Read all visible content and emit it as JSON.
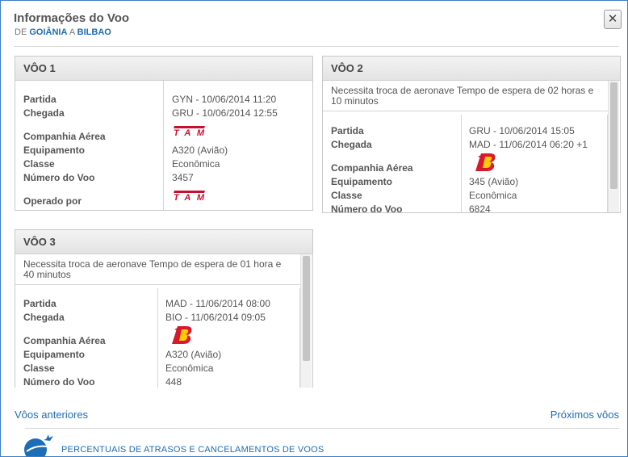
{
  "header": {
    "title": "Informações do Voo",
    "de": "DE",
    "origin": "GOIÂNIA",
    "a": "A",
    "destination": "BILBAO",
    "close_glyph": "✕"
  },
  "flights": [
    {
      "title": "VÔO 1",
      "note": "",
      "departure_label": "Partida",
      "departure_value": "GYN - 10/06/2014 11:20",
      "arrival_label": "Chegada",
      "arrival_value": "GRU - 10/06/2014 12:55",
      "airline_label": "Companhia Aérea",
      "airline_logo": "TAM",
      "equipment_label": "Equipamento",
      "equipment_value": "A320 (Avião)",
      "class_label": "Classe",
      "class_value": "Econômica",
      "flight_number_label": "Número do Voo",
      "flight_number_value": "3457",
      "operated_by_label": "Operado por",
      "operated_by_logo": "TAM"
    },
    {
      "title": "VÔO 2",
      "note": "Necessita troca de aeronave Tempo de espera de 02 horas e 10 minutos",
      "departure_label": "Partida",
      "departure_value": "GRU - 10/06/2014 15:05",
      "arrival_label": "Chegada",
      "arrival_value": "MAD - 11/06/2014 06:20 +1",
      "airline_label": "Companhia Aérea",
      "airline_logo": "iberia-icon",
      "equipment_label": "Equipamento",
      "equipment_value": "345 (Avião)",
      "class_label": "Classe",
      "class_value": "Econômica",
      "flight_number_label": "Número do Voo",
      "flight_number_value": "6824"
    },
    {
      "title": "VÔO 3",
      "note": "Necessita troca de aeronave Tempo de espera de 01 hora e 40 minutos",
      "departure_label": "Partida",
      "departure_value": "MAD - 11/06/2014 08:00",
      "arrival_label": "Chegada",
      "arrival_value": "BIO - 11/06/2014 09:05",
      "airline_label": "Companhia Aérea",
      "airline_logo": "iberia-icon",
      "equipment_label": "Equipamento",
      "equipment_value": "A320 (Avião)",
      "class_label": "Classe",
      "class_value": "Econômica",
      "flight_number_label": "Número do Voo",
      "flight_number_value": "448"
    }
  ],
  "footer": {
    "previous_label": "Vôos anteriores",
    "next_label": "Próximos vôos",
    "delay_link": "PERCENTUAIS DE ATRASOS E CANCELAMENTOS DE VOOS"
  },
  "colors": {
    "link": "#1e6db7",
    "tam_red": "#c8102e",
    "iberia_red": "#d7192d",
    "iberia_yellow": "#ffcc00"
  }
}
